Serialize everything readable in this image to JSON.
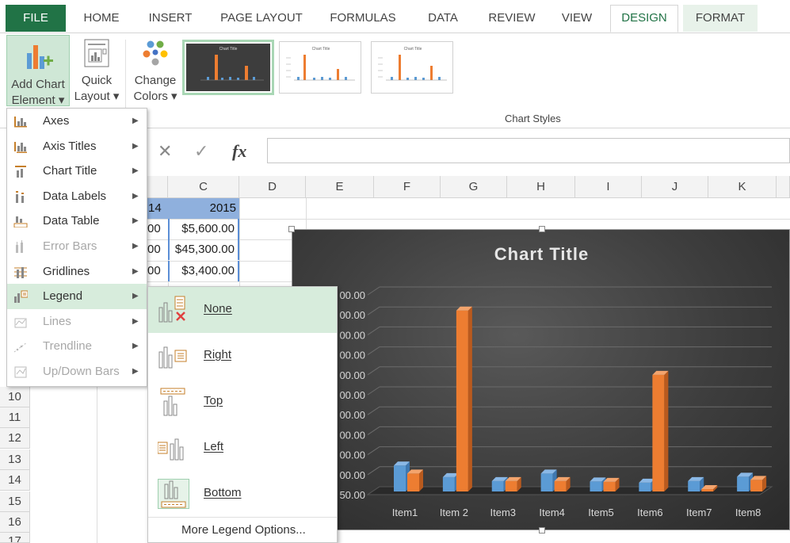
{
  "ribbon": {
    "tabs": [
      "FILE",
      "HOME",
      "INSERT",
      "PAGE LAYOUT",
      "FORMULAS",
      "DATA",
      "REVIEW",
      "VIEW",
      "DESIGN",
      "FORMAT"
    ],
    "add_chart_element": [
      "Add Chart",
      "Element ▾"
    ],
    "quick_layout": [
      "Quick",
      "Layout ▾"
    ],
    "change_colors": [
      "Change",
      "Colors ▾"
    ],
    "chart_styles_label": "Chart Styles",
    "thumb_title": "Chart Title"
  },
  "formula_bar": {
    "cancel": "✕",
    "enter": "✓",
    "fx": "fx"
  },
  "grid": {
    "columns": [
      "C",
      "D",
      "E",
      "F",
      "G",
      "H",
      "I",
      "J",
      "K"
    ],
    "rows": [
      "10",
      "11",
      "12",
      "13",
      "14",
      "15",
      "16",
      "17"
    ],
    "header_left": "14",
    "header_c": "2015",
    "cells_left": [
      "00",
      "00",
      "00"
    ],
    "cells_c": [
      "$5,600.00",
      "$45,300.00",
      "$3,400.00"
    ]
  },
  "menu": {
    "items": [
      {
        "label": "Axes",
        "icon": "axes-icon",
        "disabled": false
      },
      {
        "label": "Axis Titles",
        "icon": "axis-titles-icon",
        "disabled": false
      },
      {
        "label": "Chart Title",
        "icon": "chart-title-icon",
        "disabled": false
      },
      {
        "label": "Data Labels",
        "icon": "data-labels-icon",
        "disabled": false
      },
      {
        "label": "Data Table",
        "icon": "data-table-icon",
        "disabled": false
      },
      {
        "label": "Error Bars",
        "icon": "error-bars-icon",
        "disabled": true
      },
      {
        "label": "Gridlines",
        "icon": "gridlines-icon",
        "disabled": false
      },
      {
        "label": "Legend",
        "icon": "legend-icon",
        "disabled": false
      },
      {
        "label": "Lines",
        "icon": "lines-icon",
        "disabled": true
      },
      {
        "label": "Trendline",
        "icon": "trendline-icon",
        "disabled": true
      },
      {
        "label": "Up/Down Bars",
        "icon": "updown-bars-icon",
        "disabled": true
      }
    ],
    "arrow": "▶"
  },
  "legend_submenu": {
    "items": [
      {
        "label": "None",
        "icon": "legend-none-icon"
      },
      {
        "label": "Right",
        "icon": "legend-right-icon"
      },
      {
        "label": "Top",
        "icon": "legend-top-icon"
      },
      {
        "label": "Left",
        "icon": "legend-left-icon"
      },
      {
        "label": "Bottom",
        "icon": "legend-bottom-icon"
      }
    ],
    "more": "More Legend Options..."
  },
  "colors": {
    "accent": "#217346",
    "series1": "#5b9bd5",
    "series2": "#ed7d31"
  },
  "chart_data": {
    "type": "bar",
    "title": "Chart Title",
    "categories": [
      "Item1",
      "Item 2",
      "Item3",
      "Item4",
      "Item5",
      "Item6",
      "Item7",
      "Item8"
    ],
    "series": [
      {
        "values": [
          6500,
          3600,
          2600,
          4500,
          2500,
          2200,
          2600,
          3700
        ]
      },
      {
        "values": [
          4500,
          45300,
          2600,
          2600,
          2400,
          29200,
          500,
          2900
        ]
      }
    ],
    "y_tick_labels": [
      "50.00",
      "00.00",
      "00.00",
      "00.00",
      "00.00",
      "00.00",
      "00.00",
      "00.00",
      "00.00",
      "00.00",
      "00.00"
    ],
    "ylim": [
      0,
      50000
    ],
    "grid": true
  }
}
